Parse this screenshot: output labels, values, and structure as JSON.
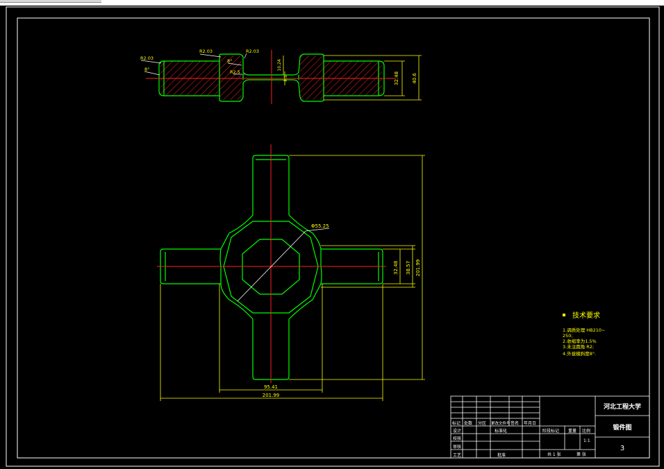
{
  "colors": {
    "background": "#000000",
    "frame": "#ffffff",
    "part_outline": "#00ff00",
    "hatch": "#ff2020",
    "center_line": "#ff2020",
    "dimension": "#ffff00",
    "leader": "#ffffff",
    "tech_req": "#ffff00"
  },
  "section_view": {
    "labels": {
      "r_left": "R2.03",
      "angle_left": "8°",
      "r_mid_left": "R2.03",
      "r_mid_right": "R2.03",
      "angle_mid": "8°",
      "r_small": "R2.5",
      "dim_inner_a": "10.24",
      "dim_inner_b": "8.1",
      "dim_height_a": "32.48",
      "dim_height_b": "40.6"
    }
  },
  "plan_view": {
    "labels": {
      "diameter": "Φ55.25",
      "dim_v1": "32.48",
      "dim_v2": "38.57",
      "dim_v3": "201.99",
      "dim_h1": "95.41",
      "dim_h2": "201.99"
    }
  },
  "tech_requirements": {
    "title": "技术要求",
    "items": [
      "1.调质处理 HB210~",
      "250;",
      "2.收缩率为1.5%",
      "3.未注圆角 R2;",
      "4.外拔模斜度8°."
    ]
  },
  "title_block": {
    "school": "河北工程大学",
    "drawing_name": "锻件图",
    "sheet_no": "3",
    "header_row": [
      "标记",
      "处数",
      "分区",
      "更改文件号",
      "签名",
      "年月日"
    ],
    "row_labels": [
      "设计",
      "审核",
      "工艺"
    ],
    "extra_label": "校核",
    "standard_label": "标准化",
    "stage_cols": [
      "阶段标记",
      "重量",
      "比例"
    ],
    "scale": "1:1",
    "approve_label": "批准",
    "sheet_count_label": "共 1 张",
    "sheet_label": "第 张"
  }
}
